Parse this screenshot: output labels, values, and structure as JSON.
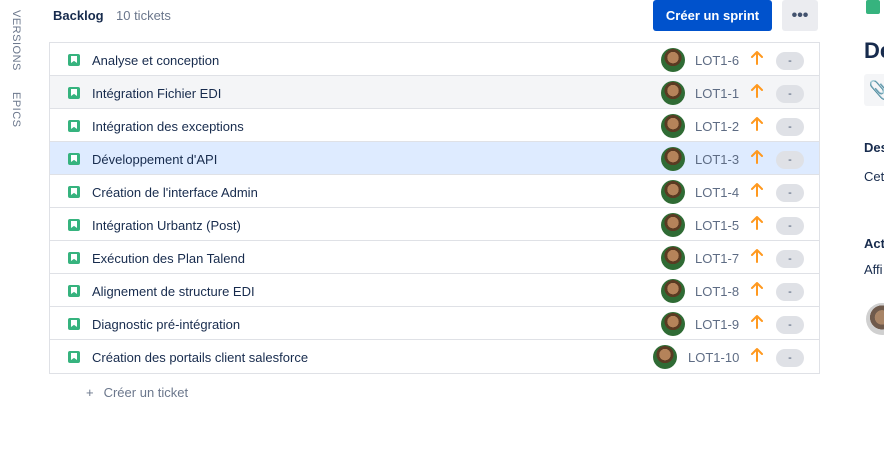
{
  "sidebar": {
    "tabs": [
      {
        "label": "VERSIONS"
      },
      {
        "label": "EPICS"
      }
    ]
  },
  "header": {
    "title": "Backlog",
    "count": "10 tickets",
    "create_sprint_label": "Créer un sprint",
    "more_label": "•••"
  },
  "colors": {
    "primary": "#0052cc",
    "story": "#36b37e",
    "priority": "#ff991f",
    "selected_row": "#deebff"
  },
  "issues": [
    {
      "summary": "Analyse et conception",
      "key": "LOT1-6",
      "status": "-",
      "priority_icon": "arrow-up-icon"
    },
    {
      "summary": "Intégration Fichier EDI",
      "key": "LOT1-1",
      "status": "-",
      "priority_icon": "arrow-up-icon"
    },
    {
      "summary": "Intégration des exceptions",
      "key": "LOT1-2",
      "status": "-",
      "priority_icon": "arrow-up-icon"
    },
    {
      "summary": "Développement d'API",
      "key": "LOT1-3",
      "status": "-",
      "priority_icon": "arrow-up-icon"
    },
    {
      "summary": "Création de l'interface Admin",
      "key": "LOT1-4",
      "status": "-",
      "priority_icon": "arrow-up-icon"
    },
    {
      "summary": "Intégration Urbantz (Post)",
      "key": "LOT1-5",
      "status": "-",
      "priority_icon": "arrow-up-icon"
    },
    {
      "summary": "Exécution des Plan Talend",
      "key": "LOT1-7",
      "status": "-",
      "priority_icon": "arrow-up-icon"
    },
    {
      "summary": "Alignement de structure EDI",
      "key": "LOT1-8",
      "status": "-",
      "priority_icon": "arrow-up-icon"
    },
    {
      "summary": "Diagnostic pré-intégration",
      "key": "LOT1-9",
      "status": "-",
      "priority_icon": "arrow-up-icon"
    },
    {
      "summary": "Création des portails client salesforce",
      "key": "LOT1-10",
      "status": "-",
      "priority_icon": "arrow-up-icon"
    }
  ],
  "footer": {
    "plus": "+",
    "create_ticket_label": "Créer un ticket"
  },
  "detail_panel": {
    "title": "De",
    "attach_icon": "paperclip-icon",
    "description_label": "Des",
    "description_text": "Cet",
    "activity_label": "Act",
    "activity_text": "Affi"
  }
}
